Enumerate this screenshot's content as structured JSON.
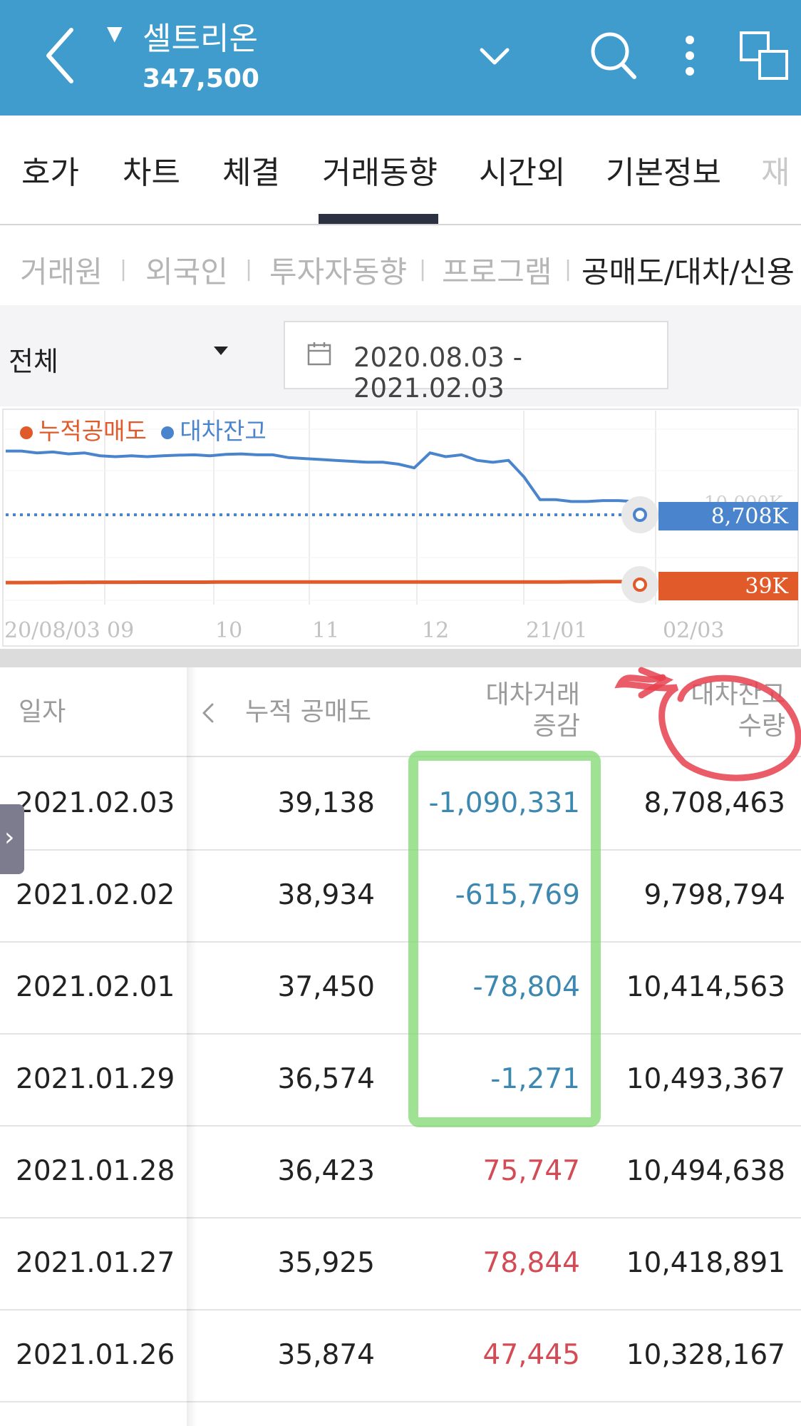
{
  "header": {
    "stock_name": "셀트리온",
    "price": "347,500",
    "caret": "▼"
  },
  "tabs": [
    {
      "label": "호가"
    },
    {
      "label": "차트"
    },
    {
      "label": "체결"
    },
    {
      "label": "거래동향"
    },
    {
      "label": "시간외"
    },
    {
      "label": "기본정보"
    },
    {
      "label": "재"
    }
  ],
  "subtabs": [
    {
      "label": "거래원"
    },
    {
      "label": "외국인"
    },
    {
      "label": "투자자동향"
    },
    {
      "label": "프로그램"
    },
    {
      "label": "공매도/대차/신용"
    }
  ],
  "filter": {
    "select_value": "전체",
    "date_range": "2020.08.03 - 2021.02.03"
  },
  "chart_data": {
    "type": "line",
    "legend": [
      "누적공매도",
      "대차잔고"
    ],
    "x_ticks": [
      "20/08/03",
      "09",
      "10",
      "11",
      "12",
      "21/01",
      "02/03"
    ],
    "series": [
      {
        "name": "대차잔고",
        "color": "#4a84cc",
        "values": [
          13200,
          13200,
          13100,
          13150,
          13050,
          13100,
          12950,
          12900,
          12950,
          12900,
          12950,
          12980,
          13000,
          12950,
          13020,
          13050,
          13000,
          13000,
          12850,
          12800,
          12750,
          12700,
          12650,
          12600,
          12600,
          12500,
          12300,
          13100,
          12900,
          13000,
          12700,
          12600,
          12700,
          11800,
          10600,
          10600,
          10500,
          10500,
          10550,
          10550,
          10500,
          8708
        ],
        "last_label": "8,708K"
      },
      {
        "name": "누적공매도",
        "color": "#e05a2a",
        "values": [
          30,
          30,
          31,
          31,
          32,
          32,
          33,
          33,
          33,
          34,
          34,
          34,
          34,
          34,
          35,
          35,
          35,
          35,
          35,
          35,
          35,
          35,
          35,
          35,
          35,
          35,
          35,
          35,
          35,
          35,
          35,
          35,
          35,
          35,
          36,
          36,
          36,
          37,
          37,
          38,
          39,
          39
        ],
        "last_label": "39K"
      }
    ],
    "faded_label": "10,000K",
    "grid": true,
    "legend_position": "top-left"
  },
  "table": {
    "headers": {
      "date": "일자",
      "short": "누적 공매도",
      "change_line1": "대차거래",
      "change_line2": "증감",
      "balance_line1": "대차잔고",
      "balance_line2": "수량"
    },
    "rows": [
      {
        "date": "2021.02.03",
        "short": "39,138",
        "change": "-1,090,331",
        "sign": "neg",
        "balance": "8,708,463"
      },
      {
        "date": "2021.02.02",
        "short": "38,934",
        "change": "-615,769",
        "sign": "neg",
        "balance": "9,798,794"
      },
      {
        "date": "2021.02.01",
        "short": "37,450",
        "change": "-78,804",
        "sign": "neg",
        "balance": "10,414,563"
      },
      {
        "date": "2021.01.29",
        "short": "36,574",
        "change": "-1,271",
        "sign": "neg",
        "balance": "10,493,367"
      },
      {
        "date": "2021.01.28",
        "short": "36,423",
        "change": "75,747",
        "sign": "pos",
        "balance": "10,494,638"
      },
      {
        "date": "2021.01.27",
        "short": "35,925",
        "change": "78,844",
        "sign": "pos",
        "balance": "10,418,891"
      },
      {
        "date": "2021.01.26",
        "short": "35,874",
        "change": "47,445",
        "sign": "pos",
        "balance": "10,328,167"
      }
    ]
  },
  "colors": {
    "header_bg": "#3f9ccc",
    "negative": "#3c88b0",
    "positive": "#d34b55",
    "annotation_red": "#e8404f",
    "annotation_green": "#7fd870"
  },
  "icons": {
    "back": "chevron-left-icon",
    "dropdown": "chevron-down-icon",
    "search": "search-icon",
    "more": "more-vertical-icon",
    "window": "window-icon",
    "calendar": "calendar-icon",
    "scroll_left": "chevron-left-icon",
    "side_handle": "chevron-right-icon"
  }
}
